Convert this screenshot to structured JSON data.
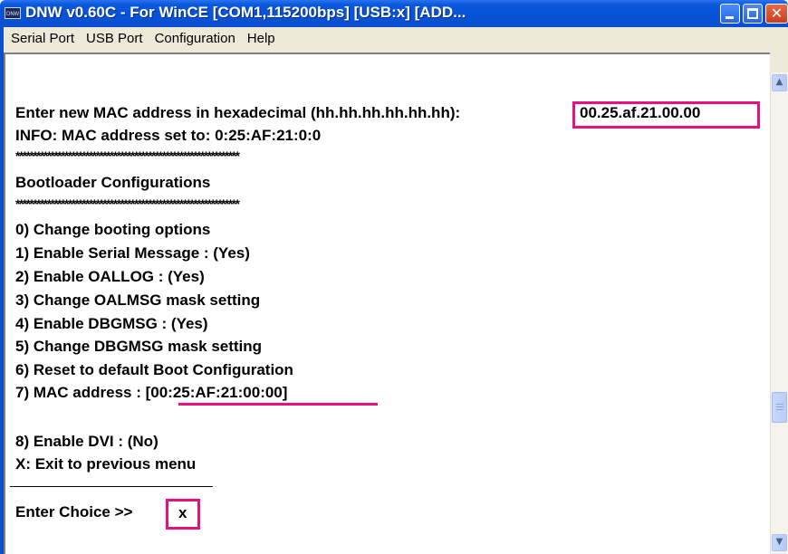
{
  "window": {
    "title": "DNW v0.60C - For WinCE   [COM1,115200bps] [USB:x] [ADD...",
    "app_icon_text": "DNW",
    "minimize_glyph": "",
    "maximize_glyph": "",
    "close_glyph": "✕"
  },
  "menu": {
    "items": [
      "Serial Port",
      "USB Port",
      "Configuration",
      "Help"
    ]
  },
  "terminal": {
    "mac_prompt": "Enter new MAC address in hexadecimal (hh.hh.hh.hh.hh.hh):",
    "mac_input": "00.25.af.21.00.00",
    "info_line": "INFO: MAC address set to: 0:25:AF:21:0:0",
    "stars_top": "****************************************************************",
    "section_title": "Bootloader Configurations",
    "stars_bottom": "****************************************************************",
    "options": [
      "0) Change booting options",
      "1) Enable Serial Message : (Yes)",
      "2) Enable OALLOG : (Yes)",
      "3) Change OALMSG mask setting",
      "4) Enable DBGMSG : (Yes)",
      "5) Change DBGMSG mask setting",
      "6) Reset to default Boot Configuration",
      "7) MAC address : [00:25:AF:21:00:00]",
      "8) Enable DVI : (No)",
      "X: Exit to previous menu"
    ],
    "choice_prompt": "Enter Choice >>",
    "choice_input": "x"
  },
  "scrollbar": {
    "up_glyph": "▲",
    "down_glyph": "▼"
  },
  "colors": {
    "titlebar": "#0753d7",
    "highlight": "#e8117f",
    "menubar": "#ece9d8"
  }
}
